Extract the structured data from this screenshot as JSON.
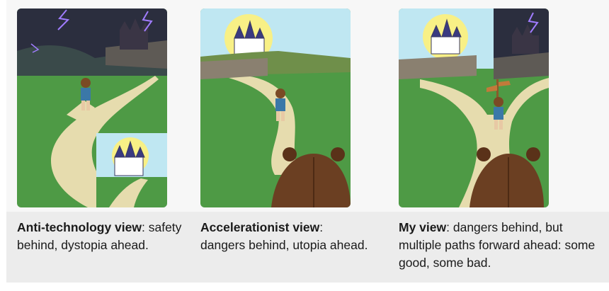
{
  "panels": [
    {
      "title": "Anti-technology view",
      "description": "safety behind, dystopia ahead."
    },
    {
      "title": "Accelerationist view",
      "description": "dangers behind, utopia ahead."
    },
    {
      "title": "My view",
      "description": "dangers behind, but multiple paths forward ahead: some good, some bad."
    }
  ],
  "colors": {
    "storm_sky": "#2b2e3e",
    "bright_sky": "#bfe7f2",
    "grass": "#4e9a45",
    "path": "#e6dcae",
    "bear": "#6b3f22",
    "boy_shirt": "#3b78a8"
  }
}
